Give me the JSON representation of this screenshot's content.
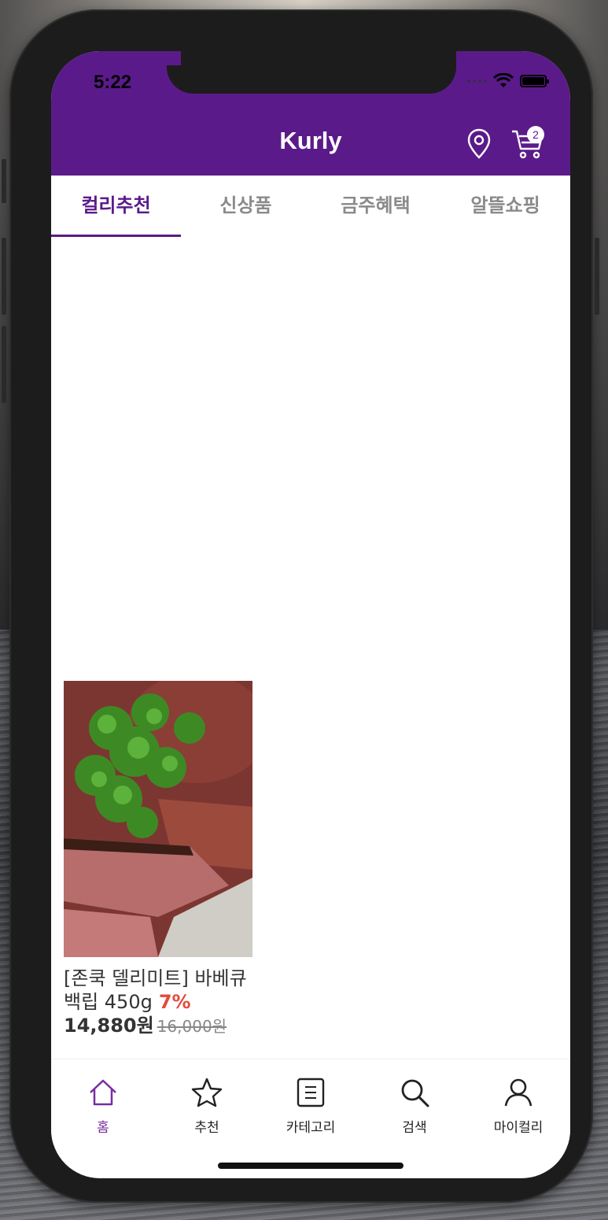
{
  "status_bar": {
    "time": "5:22"
  },
  "header": {
    "title": "Kurly",
    "cart_count": "2",
    "accent_color": "#5b1a8a"
  },
  "tabs": [
    {
      "label": "컬리추천",
      "active": true
    },
    {
      "label": "신상품",
      "active": false
    },
    {
      "label": "금주혜택",
      "active": false
    },
    {
      "label": "알뜰쇼핑",
      "active": false
    }
  ],
  "product": {
    "name": "[존쿡 델리미트] 바베큐 백립 450g",
    "discount": "7%",
    "price": "14,880원",
    "original_price": "16,000원"
  },
  "bottom_nav": [
    {
      "label": "홈",
      "icon": "home-icon",
      "active": true
    },
    {
      "label": "추천",
      "icon": "star-icon",
      "active": false
    },
    {
      "label": "카테고리",
      "icon": "list-icon",
      "active": false
    },
    {
      "label": "검색",
      "icon": "search-icon",
      "active": false
    },
    {
      "label": "마이컬리",
      "icon": "user-icon",
      "active": false
    }
  ]
}
